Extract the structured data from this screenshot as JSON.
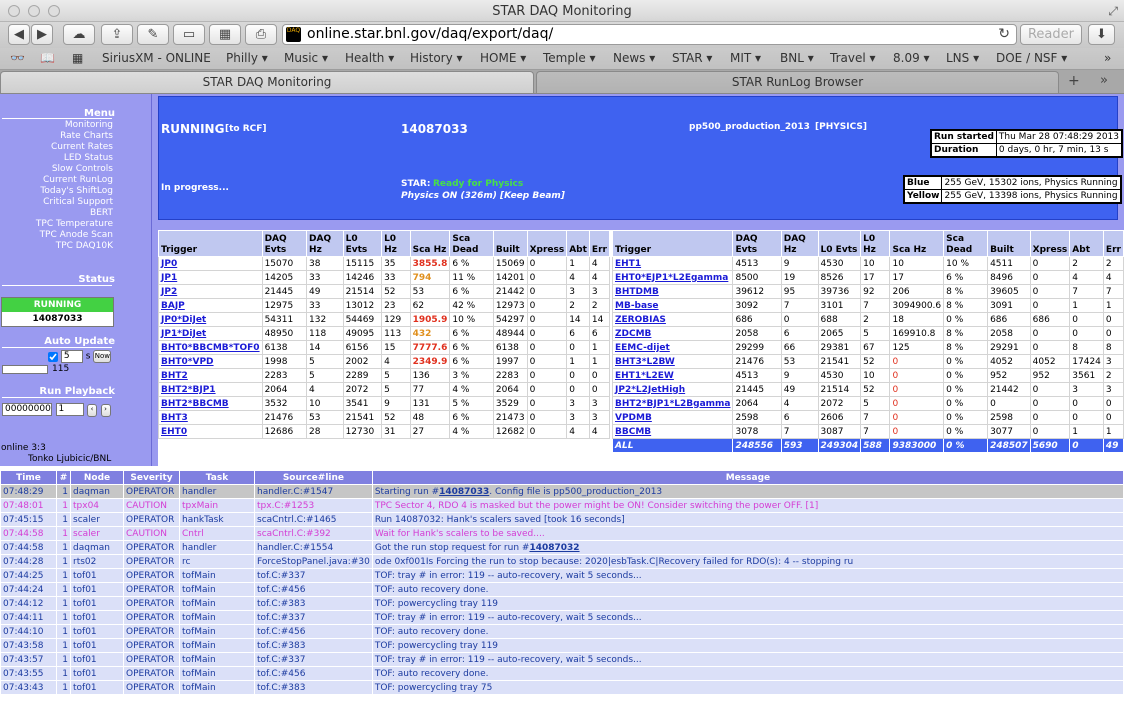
{
  "window": {
    "title": "STAR DAQ Monitoring"
  },
  "toolbar": {
    "url": "online.star.bnl.gov/daq/export/daq/",
    "reader": "Reader"
  },
  "bookmarks": [
    "SiriusXM - ONLINE",
    "Philly ▾",
    "Music ▾",
    "Health ▾",
    "History ▾",
    "HOME ▾",
    "Temple ▾",
    "News ▾",
    "STAR ▾",
    "MIT ▾",
    "BNL ▾",
    "Travel ▾",
    "8.09 ▾",
    "LNS ▾",
    "DOE / NSF ▾"
  ],
  "tabs": [
    "STAR DAQ Monitoring",
    "STAR RunLog Browser"
  ],
  "sidebar": {
    "menu_title": "Menu",
    "menu": [
      "Monitoring",
      "Rate Charts",
      "Current Rates",
      "LED Status",
      "Slow Controls",
      "Current RunLog",
      "Today's ShiftLog",
      "Critical Support",
      "BERT",
      "TPC Temperature",
      "TPC Anode Scan",
      "TPC DAQ10K"
    ],
    "status_title": "Status",
    "status": "RUNNING",
    "run": "14087033",
    "auto_title": "Auto Update",
    "auto_value": "5",
    "auto_unit": "s",
    "now": "Now",
    "countdown": "115",
    "playback_title": "Run Playback",
    "playback_a": "00000000",
    "playback_b": "1",
    "online": "online 3:3",
    "user": "Tonko Ljubicic/BNL"
  },
  "banner": {
    "state": "RUNNING",
    "state_note": "[to RCF]",
    "run": "14087033",
    "config": "pp500_production_2013",
    "config_note": "[PHYSICS]",
    "progress": "In progress...",
    "star_label": "STAR:",
    "star_status": "Ready for Physics",
    "physics": "Physics ON (326m) [Keep Beam]",
    "started_label": "Run started",
    "started": "Thu Mar 28 07:48:29 2013",
    "duration_label": "Duration",
    "duration": "0 days, 0 hr, 7 min, 13 s",
    "blue_label": "Blue",
    "blue": "255 GeV, 15302 ions, Physics Running",
    "yellow_label": "Yellow",
    "yellow": "255 GeV, 13398 ions, Physics Running"
  },
  "trigger_headers": [
    "Trigger",
    "DAQ Evts",
    "DAQ Hz",
    "L0 Evts",
    "L0 Hz",
    "Sca Hz",
    "Sca Dead",
    "Built",
    "Xpress",
    "Abt",
    "Err"
  ],
  "trigger_left": [
    [
      "JP0",
      "15070",
      "38",
      "15115",
      "35",
      "3855.8",
      "6 %",
      "15069",
      "0",
      "1",
      "4"
    ],
    [
      "JP1",
      "14205",
      "33",
      "14246",
      "33",
      "794",
      "11 %",
      "14201",
      "0",
      "4",
      "4"
    ],
    [
      "JP2",
      "21445",
      "49",
      "21514",
      "52",
      "53",
      "6 %",
      "21442",
      "0",
      "3",
      "3"
    ],
    [
      "BAJP",
      "12975",
      "33",
      "13012",
      "23",
      "62",
      "42 %",
      "12973",
      "0",
      "2",
      "2"
    ],
    [
      "JP0*DiJet",
      "54311",
      "132",
      "54469",
      "129",
      "1905.9",
      "10 %",
      "54297",
      "0",
      "14",
      "14"
    ],
    [
      "JP1*DiJet",
      "48950",
      "118",
      "49095",
      "113",
      "432",
      "6 %",
      "48944",
      "0",
      "6",
      "6"
    ],
    [
      "BHT0*BBCMB*TOF0",
      "6138",
      "14",
      "6156",
      "15",
      "7777.6",
      "6 %",
      "6138",
      "0",
      "0",
      "1"
    ],
    [
      "BHT0*VPD",
      "1998",
      "5",
      "2002",
      "4",
      "2349.9",
      "6 %",
      "1997",
      "0",
      "1",
      "1"
    ],
    [
      "BHT2",
      "2283",
      "5",
      "2289",
      "5",
      "136",
      "3 %",
      "2283",
      "0",
      "0",
      "0"
    ],
    [
      "BHT2*BJP1",
      "2064",
      "4",
      "2072",
      "5",
      "77",
      "4 %",
      "2064",
      "0",
      "0",
      "0"
    ],
    [
      "BHT2*BBCMB",
      "3532",
      "10",
      "3541",
      "9",
      "131",
      "5 %",
      "3529",
      "0",
      "3",
      "3"
    ],
    [
      "BHT3",
      "21476",
      "53",
      "21541",
      "52",
      "48",
      "6 %",
      "21473",
      "0",
      "3",
      "3"
    ],
    [
      "EHT0",
      "12686",
      "28",
      "12730",
      "31",
      "27",
      "4 %",
      "12682",
      "0",
      "4",
      "4"
    ]
  ],
  "trigger_right": [
    [
      "EHT1",
      "4513",
      "9",
      "4530",
      "10",
      "10",
      "10 %",
      "4511",
      "0",
      "2",
      "2"
    ],
    [
      "EHT0*EJP1*L2Egamma",
      "8500",
      "19",
      "8526",
      "17",
      "17",
      "6 %",
      "8496",
      "0",
      "4",
      "4"
    ],
    [
      "BHTDMB",
      "39612",
      "95",
      "39736",
      "92",
      "206",
      "8 %",
      "39605",
      "0",
      "7",
      "7"
    ],
    [
      "MB-base",
      "3092",
      "7",
      "3101",
      "7",
      "3094900.6",
      "8 %",
      "3091",
      "0",
      "1",
      "1"
    ],
    [
      "ZEROBIAS",
      "686",
      "0",
      "688",
      "2",
      "18",
      "0 %",
      "686",
      "686",
      "0",
      "0"
    ],
    [
      "ZDCMB",
      "2058",
      "6",
      "2065",
      "5",
      "169910.8",
      "8 %",
      "2058",
      "0",
      "0",
      "0"
    ],
    [
      "EEMC-dijet",
      "29299",
      "66",
      "29381",
      "67",
      "125",
      "8 %",
      "29291",
      "0",
      "8",
      "8"
    ],
    [
      "BHT3*L2BW",
      "21476",
      "53",
      "21541",
      "52",
      "0",
      "0 %",
      "4052",
      "4052",
      "17424",
      "3"
    ],
    [
      "EHT1*L2EW",
      "4513",
      "9",
      "4530",
      "10",
      "0",
      "0 %",
      "952",
      "952",
      "3561",
      "2"
    ],
    [
      "JP2*L2JetHigh",
      "21445",
      "49",
      "21514",
      "52",
      "0",
      "0 %",
      "21442",
      "0",
      "3",
      "3"
    ],
    [
      "BHT2*BJP1*L2Bgamma",
      "2064",
      "4",
      "2072",
      "5",
      "0",
      "0 %",
      "0",
      "0",
      "0",
      "0"
    ],
    [
      "VPDMB",
      "2598",
      "6",
      "2606",
      "7",
      "0",
      "0 %",
      "2598",
      "0",
      "0",
      "0"
    ],
    [
      "BBCMB",
      "3078",
      "7",
      "3087",
      "7",
      "0",
      "0 %",
      "3077",
      "0",
      "1",
      "1"
    ]
  ],
  "trigger_all": [
    "ALL",
    "248556",
    "593",
    "249304",
    "588",
    "9383000",
    "0 %",
    "248507",
    "5690",
    "0",
    "49"
  ],
  "log_headers": [
    "Time",
    "#",
    "Node",
    "Severity",
    "Task",
    "Source#line",
    "Message"
  ],
  "log": [
    {
      "time": "07:48:29",
      "n": "1",
      "node": "daqman",
      "sev": "OPERATOR",
      "task": "handler",
      "src": "handler.C:#1547",
      "pre": "Starting run #",
      "link": "14087033",
      "post": ". Config file is pp500_production_2013",
      "cls": "sel"
    },
    {
      "time": "07:48:01",
      "n": "1",
      "node": "tpx04",
      "sev": "CAUTION",
      "task": "tpxMain",
      "src": "tpx.C:#1253",
      "pre": "TPC Sector 4, RDO 4 is masked but the power might be ON! Consider switching the power OFF. [1]",
      "link": "",
      "post": "",
      "cls": "cau"
    },
    {
      "time": "07:45:15",
      "n": "1",
      "node": "scaler",
      "sev": "OPERATOR",
      "task": "hankTask",
      "src": "scaCntrl.C:#1465",
      "pre": "Run 14087032: Hank's scalers saved [took 16 seconds]",
      "link": "",
      "post": "",
      "cls": "op"
    },
    {
      "time": "07:44:58",
      "n": "1",
      "node": "scaler",
      "sev": "CAUTION",
      "task": "Cntrl",
      "src": "scaCntrl.C:#392",
      "pre": "Wait for Hank's scalers to be saved....",
      "link": "",
      "post": "",
      "cls": "cau"
    },
    {
      "time": "07:44:58",
      "n": "1",
      "node": "daqman",
      "sev": "OPERATOR",
      "task": "handler",
      "src": "handler.C:#1554",
      "pre": "Got the run stop request for run #",
      "link": "14087032",
      "post": "",
      "cls": "op"
    },
    {
      "time": "07:44:28",
      "n": "1",
      "node": "rts02",
      "sev": "OPERATOR",
      "task": "rc",
      "src": "ForceStopPanel.java:#30",
      "pre": "ode 0xf001Is Forcing the run to stop because: 2020|esbTask.C|Recovery failed for RDO(s): 4 -- stopping ru",
      "link": "",
      "post": "",
      "cls": "op"
    },
    {
      "time": "07:44:25",
      "n": "1",
      "node": "tof01",
      "sev": "OPERATOR",
      "task": "tofMain",
      "src": "tof.C:#337",
      "pre": "TOF: tray # in error: 119 -- auto-recovery, wait 5 seconds...",
      "link": "",
      "post": "",
      "cls": "op"
    },
    {
      "time": "07:44:24",
      "n": "1",
      "node": "tof01",
      "sev": "OPERATOR",
      "task": "tofMain",
      "src": "tof.C:#456",
      "pre": "TOF: auto recovery done.",
      "link": "",
      "post": "",
      "cls": "op"
    },
    {
      "time": "07:44:12",
      "n": "1",
      "node": "tof01",
      "sev": "OPERATOR",
      "task": "tofMain",
      "src": "tof.C:#383",
      "pre": "TOF: powercycling tray 119",
      "link": "",
      "post": "",
      "cls": "op"
    },
    {
      "time": "07:44:11",
      "n": "1",
      "node": "tof01",
      "sev": "OPERATOR",
      "task": "tofMain",
      "src": "tof.C:#337",
      "pre": "TOF: tray # in error: 119 -- auto-recovery, wait 5 seconds...",
      "link": "",
      "post": "",
      "cls": "op"
    },
    {
      "time": "07:44:10",
      "n": "1",
      "node": "tof01",
      "sev": "OPERATOR",
      "task": "tofMain",
      "src": "tof.C:#456",
      "pre": "TOF: auto recovery done.",
      "link": "",
      "post": "",
      "cls": "op"
    },
    {
      "time": "07:43:58",
      "n": "1",
      "node": "tof01",
      "sev": "OPERATOR",
      "task": "tofMain",
      "src": "tof.C:#383",
      "pre": "TOF: powercycling tray 119",
      "link": "",
      "post": "",
      "cls": "op"
    },
    {
      "time": "07:43:57",
      "n": "1",
      "node": "tof01",
      "sev": "OPERATOR",
      "task": "tofMain",
      "src": "tof.C:#337",
      "pre": "TOF: tray # in error: 119 -- auto-recovery, wait 5 seconds...",
      "link": "",
      "post": "",
      "cls": "op"
    },
    {
      "time": "07:43:55",
      "n": "1",
      "node": "tof01",
      "sev": "OPERATOR",
      "task": "tofMain",
      "src": "tof.C:#456",
      "pre": "TOF: auto recovery done.",
      "link": "",
      "post": "",
      "cls": "op"
    },
    {
      "time": "07:43:43",
      "n": "1",
      "node": "tof01",
      "sev": "OPERATOR",
      "task": "tofMain",
      "src": "tof.C:#383",
      "pre": "TOF: powercycling tray 75",
      "link": "",
      "post": "",
      "cls": "op"
    }
  ]
}
